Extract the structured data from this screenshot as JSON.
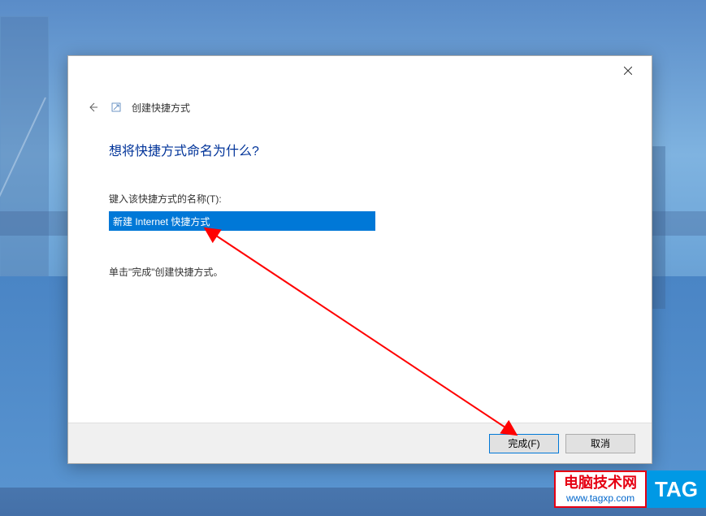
{
  "dialog": {
    "wizard_title": "创建快捷方式",
    "main_heading": "想将快捷方式命名为什么?",
    "field_label": "键入该快捷方式的名称(T):",
    "input_value": "新建 Internet 快捷方式",
    "instruction": "单击\"完成\"创建快捷方式。",
    "finish_button": "完成(F)",
    "cancel_button": "取消"
  },
  "watermark": {
    "title": "电脑技术网",
    "url": "www.tagxp.com",
    "tag": "TAG"
  }
}
